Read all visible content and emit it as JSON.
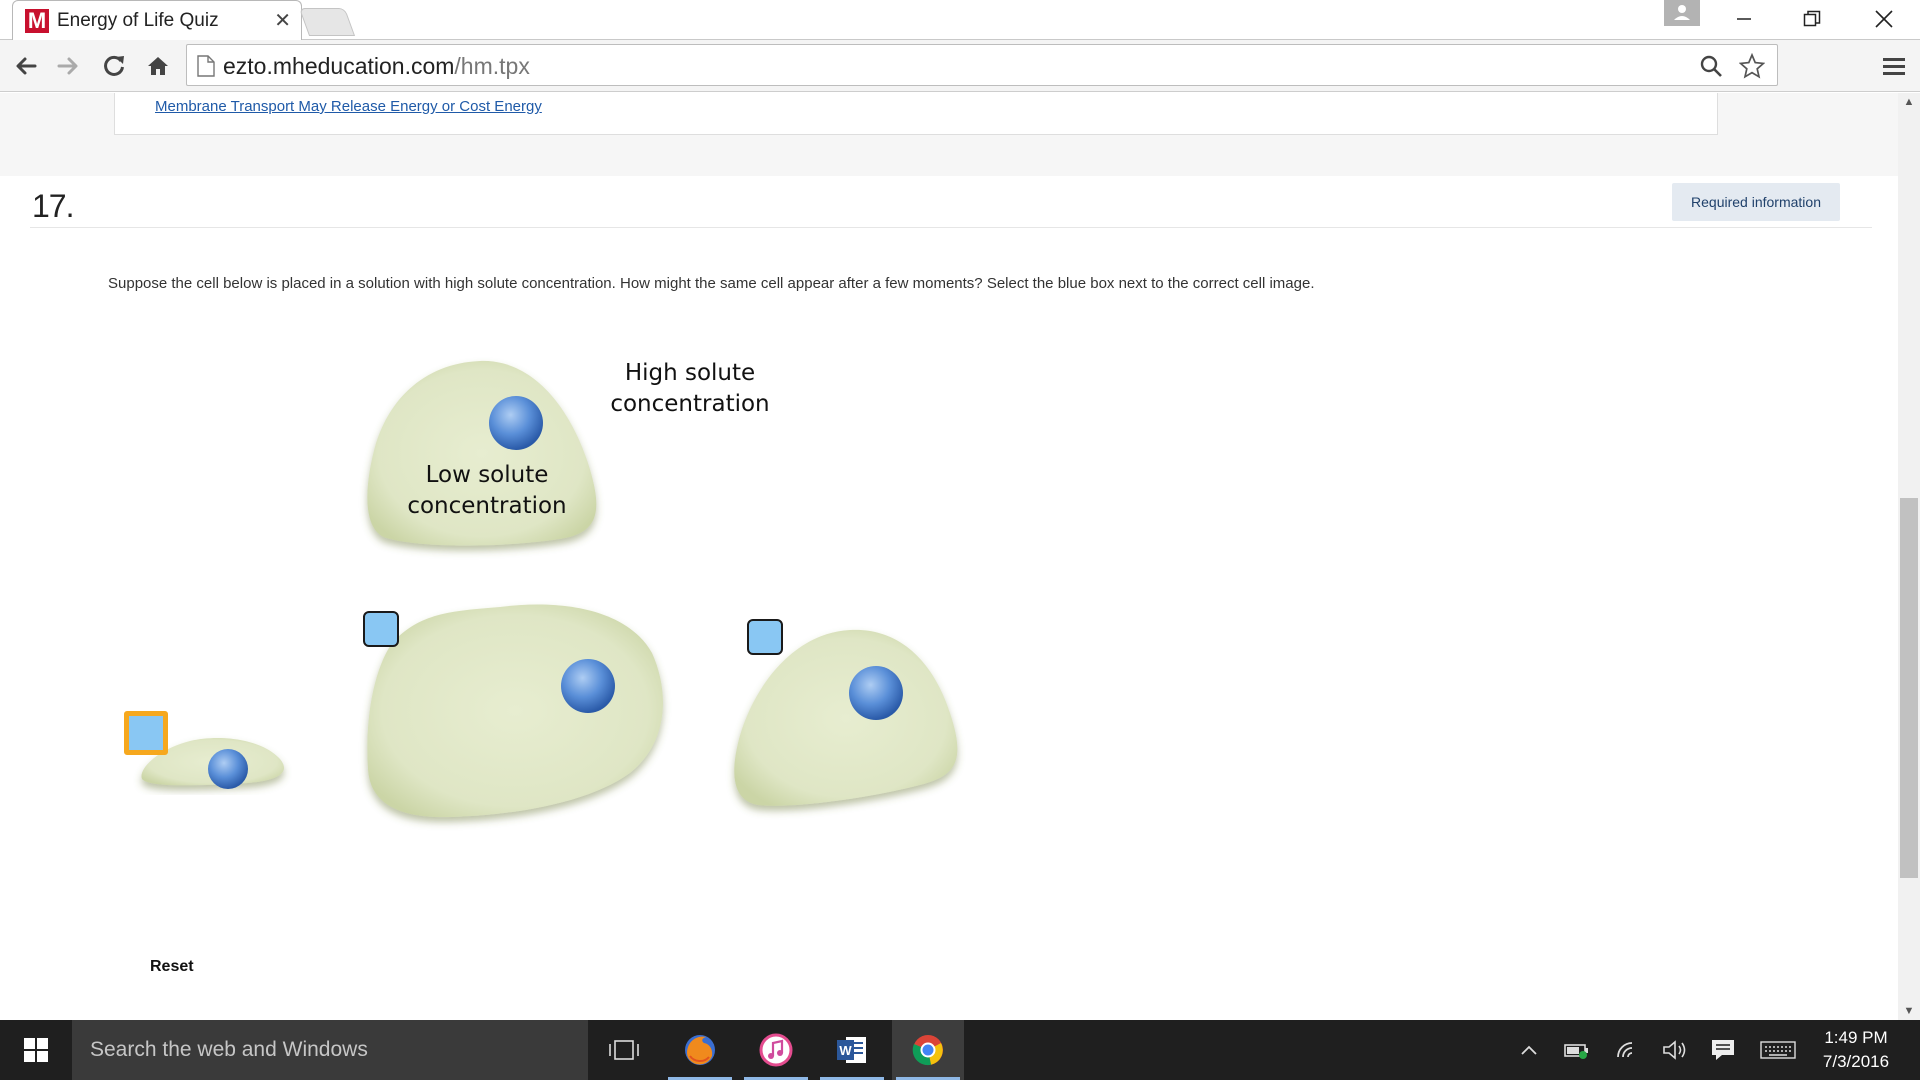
{
  "browser": {
    "tab_title": "Energy of Life Quiz",
    "tab_favicon_letter": "M",
    "tab_close_glyph": "✕",
    "url_domain": "ezto.mheducation.com",
    "url_path": "/hm.tpx"
  },
  "page": {
    "prev_link": "Membrane Transport May Release Energy or Cost Energy",
    "question_number": "17.",
    "required_info": "Required information",
    "question_text": "Suppose the cell below is placed in a solution with high solute concentration. How might the same cell appear after a few moments? Select the blue box next to the correct cell image.",
    "figure": {
      "outside_label_line1": "High solute",
      "outside_label_line2": "concentration",
      "inside_label_line1": "Low solute",
      "inside_label_line2": "concentration"
    },
    "reset_label": "Reset"
  },
  "taskbar": {
    "search_placeholder": "Search the web and Windows",
    "time": "1:49 PM",
    "date": "7/3/2016"
  },
  "colors": {
    "cell_fill": "#dfe6c5",
    "nucleus": "#4f86d6",
    "choice_box": "#89c7f3",
    "selected_outline": "#f6a81e"
  },
  "icons": {
    "back": "arrow-left-icon",
    "forward": "arrow-right-icon",
    "reload": "reload-icon",
    "home": "home-icon",
    "zoom": "magnifier-icon",
    "bookmark": "star-icon",
    "menu": "hamburger-icon"
  }
}
